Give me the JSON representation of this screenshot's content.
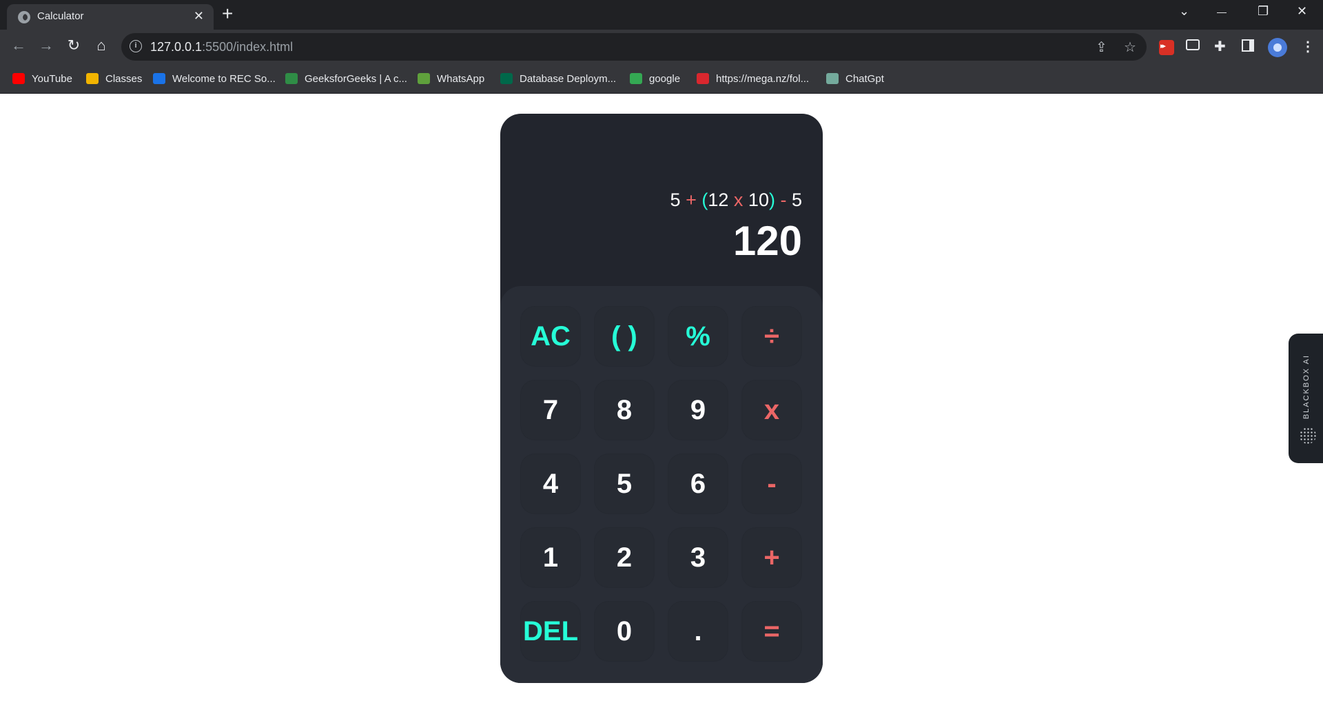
{
  "browser": {
    "tab_title": "Calculator",
    "tab_close": "✕",
    "new_tab": "+",
    "url_host": "127.0.0.1",
    "url_path": ":5500/index.html",
    "window_controls": {
      "dropdown": "⌄",
      "minimize": "—",
      "restore": "❐",
      "close": "✕"
    },
    "nav": {
      "back": "←",
      "forward": "→",
      "reload": "↻",
      "home": "⌂"
    },
    "omnibox_icons": {
      "share": "⇪",
      "star": "☆"
    },
    "extension_icons": [
      "pip-icon",
      "puzzle-icon",
      "sidepanel-icon",
      "menu-icon"
    ],
    "bookmarks": [
      {
        "label": "YouTube",
        "icon": "youtube-icon",
        "color": "#ff0000"
      },
      {
        "label": "Classes",
        "icon": "classroom-icon",
        "color": "#f2b400"
      },
      {
        "label": "Welcome to REC So...",
        "icon": "rec-icon",
        "color": "#1a73e8"
      },
      {
        "label": "GeeksforGeeks | A c...",
        "icon": "gfg-icon",
        "color": "#2f8d46"
      },
      {
        "label": "WhatsApp",
        "icon": "whatsapp-icon",
        "color": "#5fa03c"
      },
      {
        "label": "Database Deploym...",
        "icon": "mongodb-icon",
        "color": "#00684a"
      },
      {
        "label": "google",
        "icon": "google-sheet-icon",
        "color": "#34a853"
      },
      {
        "label": "https://mega.nz/fol...",
        "icon": "mega-icon",
        "color": "#d9272e"
      },
      {
        "label": "ChatGpt",
        "icon": "chatgpt-icon",
        "color": "#74aa9c"
      }
    ]
  },
  "calculator": {
    "expression": {
      "parts": [
        {
          "t": "5 ",
          "c": "num"
        },
        {
          "t": "+ ",
          "c": "op"
        },
        {
          "t": "(",
          "c": "par"
        },
        {
          "t": "12 ",
          "c": "num"
        },
        {
          "t": "x ",
          "c": "op"
        },
        {
          "t": "10",
          "c": "num"
        },
        {
          "t": ")",
          "c": "par"
        },
        {
          "t": " - ",
          "c": "op"
        },
        {
          "t": "5",
          "c": "num"
        }
      ]
    },
    "result": "120",
    "keys": [
      [
        {
          "label": "AC",
          "type": "func",
          "name": "clear-button"
        },
        {
          "label": "( )",
          "type": "func",
          "name": "parentheses-button"
        },
        {
          "label": "%",
          "type": "func",
          "name": "percent-button"
        },
        {
          "label": "÷",
          "type": "op",
          "name": "divide-button"
        }
      ],
      [
        {
          "label": "7",
          "type": "num",
          "name": "digit-7-button"
        },
        {
          "label": "8",
          "type": "num",
          "name": "digit-8-button"
        },
        {
          "label": "9",
          "type": "num",
          "name": "digit-9-button"
        },
        {
          "label": "x",
          "type": "op",
          "name": "multiply-button"
        }
      ],
      [
        {
          "label": "4",
          "type": "num",
          "name": "digit-4-button"
        },
        {
          "label": "5",
          "type": "num",
          "name": "digit-5-button"
        },
        {
          "label": "6",
          "type": "num",
          "name": "digit-6-button"
        },
        {
          "label": "-",
          "type": "op",
          "name": "subtract-button"
        }
      ],
      [
        {
          "label": "1",
          "type": "num",
          "name": "digit-1-button"
        },
        {
          "label": "2",
          "type": "num",
          "name": "digit-2-button"
        },
        {
          "label": "3",
          "type": "num",
          "name": "digit-3-button"
        },
        {
          "label": "+",
          "type": "op",
          "name": "add-button"
        }
      ],
      [
        {
          "label": "DEL",
          "type": "func",
          "name": "delete-button"
        },
        {
          "label": "0",
          "type": "num",
          "name": "digit-0-button"
        },
        {
          "label": ".",
          "type": "num",
          "name": "decimal-button"
        },
        {
          "label": "=",
          "type": "op",
          "name": "equals-button"
        }
      ]
    ],
    "colors": {
      "func": "#26fed7",
      "op": "#eb6666",
      "num": "#ffffff",
      "body": "#22252d",
      "keypad": "#292d36"
    }
  },
  "blackbox": {
    "label": "BLACKBOX AI"
  }
}
